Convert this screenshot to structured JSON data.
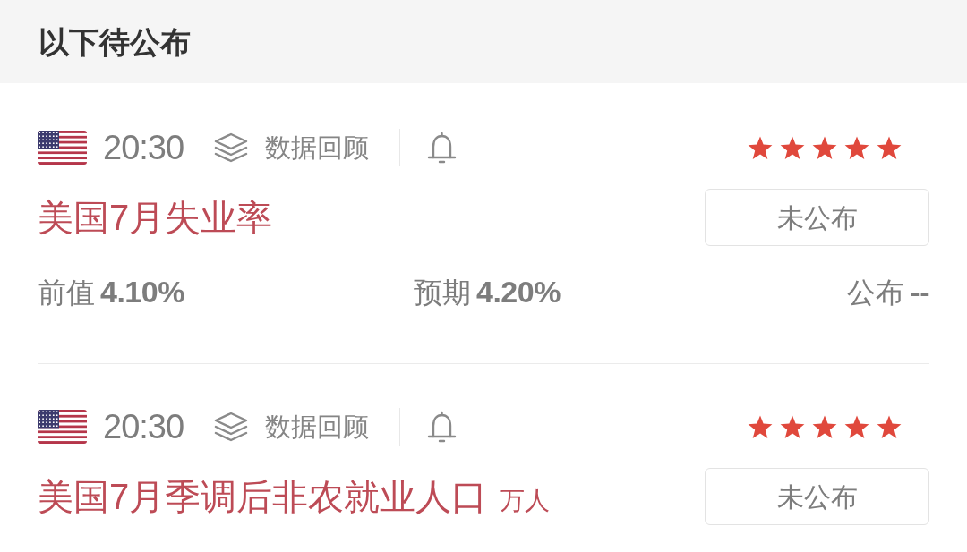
{
  "header": {
    "title": "以下待公布"
  },
  "events": [
    {
      "time": "20:30",
      "review_label": "数据回顾",
      "stars": 5,
      "title": "美国7月失业率",
      "status": "未公布",
      "values": [
        {
          "label": "前值",
          "value": "4.10%"
        },
        {
          "label": "预期",
          "value": "4.20%"
        },
        {
          "label": "公布",
          "value": "--"
        }
      ]
    },
    {
      "time": "20:30",
      "review_label": "数据回顾",
      "stars": 5,
      "title": "美国7月季调后非农就业人口",
      "unit": "万人",
      "status": "未公布"
    }
  ]
}
